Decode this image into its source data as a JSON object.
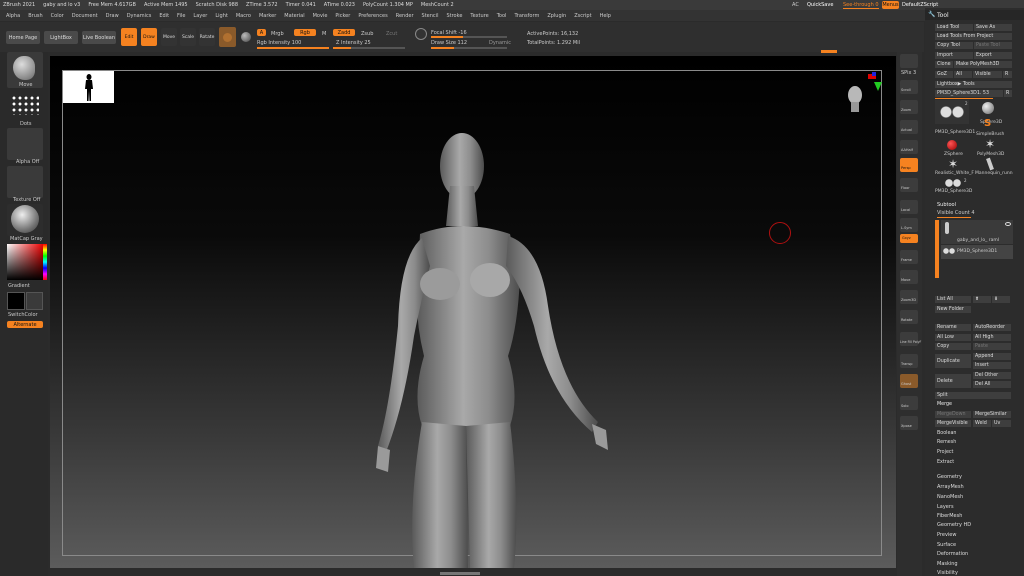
{
  "titlebar": {
    "items": [
      "ZBrush 2021",
      "gaby and lo v3",
      "Free Mem 4.617GB",
      "Active Mem 1495",
      "Scratch Disk 988",
      "ZTime 3.572",
      "Timer 0.041",
      "ATime 0.023",
      "PolyCount 1.304 MP",
      "MeshCount 2"
    ],
    "ai": "AC",
    "quicksave": "QuickSave",
    "seethrough": "See-through  0",
    "menus_btn": "Menus",
    "defaultzscript": "DefaultZScript"
  },
  "menubar": {
    "items": [
      "Alpha",
      "Brush",
      "Color",
      "Document",
      "Draw",
      "Dynamics",
      "Edit",
      "File",
      "Layer",
      "Light",
      "Macro",
      "Marker",
      "Material",
      "Movie",
      "Picker",
      "Preferences",
      "Render",
      "Stencil",
      "Stroke",
      "Texture",
      "Tool",
      "Transform",
      "Zplugin",
      "Zscript",
      "Help"
    ]
  },
  "shelf": {
    "home_page": "Home Page",
    "lightbox": "LightBox",
    "live_boolean": "Live Boolean",
    "edit": "Edit",
    "draw": "Draw",
    "move": "Move",
    "scale": "Scale",
    "rotate": "Rotate",
    "a_label": "A",
    "mrgb": "Mrgb",
    "rgb": "Rgb",
    "m": "M",
    "zadd": "Zadd",
    "zsub": "Zsub",
    "zcut": "Zcut",
    "rgb_intensity": "Rgb Intensity 100",
    "z_intensity": "Z Intensity 25",
    "focal_shift": "Focal Shift -16",
    "draw_size": "Draw Size 112",
    "dynamic": "Dynamic",
    "active_points": "ActivePoints: 16,132",
    "total_points": "TotalPoints: 1.292 Mil"
  },
  "lefttray": {
    "move": "Move",
    "dots": "Dots",
    "alpha_off": "Alpha Off",
    "texture_off": "Texture Off",
    "matcap": "MatCap Gray",
    "gradient": "Gradient",
    "switchcolor": "SwitchColor",
    "alternate": "Alternate"
  },
  "righttray": {
    "spix": "SPix 3",
    "scroll": "Scroll",
    "zoom": "Zoom",
    "actual": "Actual",
    "aahalf": "AAHalf",
    "persp": "Persp",
    "floor": "Floor",
    "local": "Local",
    "lsym": "L.Sym",
    "gxyz": "Gxyz",
    "frame": "Frame",
    "move": "Move",
    "zoom3d": "Zoom3D",
    "rotate": "Rotate",
    "linefill": "Line Fill PolyF",
    "transp": "Transp",
    "ghost": "Ghost",
    "solo": "Solo",
    "xpose": "Xpose"
  },
  "tool": {
    "header": "Tool",
    "load_tool": "Load Tool",
    "save_as": "Save As",
    "load_from_project": "Load Tools From Project",
    "copy_tool": "Copy Tool",
    "paste_tool": "Paste Tool",
    "import": "Import",
    "export": "Export",
    "clone": "Clone",
    "make_polymesh": "Make PolyMesh3D",
    "goz": "GoZ",
    "all": "All",
    "visible": "Visible",
    "r": "R",
    "lightbox_tools": "Lightbox▶ Tools",
    "current_tool": "PM3D_Sphere3D1. 53",
    "r2": "R",
    "thumbs": [
      {
        "label": "PM3D_Sphere3D1",
        "count": "2"
      },
      {
        "label": "Sphere3D",
        "count": ""
      },
      {
        "label": "SimpleBrush",
        "count": ""
      },
      {
        "label": "ZSphere",
        "count": ""
      },
      {
        "label": "PolyMesh3D",
        "count": ""
      },
      {
        "label": "Realistic_White_F",
        "count": ""
      },
      {
        "label": "Mannequin_runn",
        "count": ""
      },
      {
        "label": "PM3D_Sphere3D",
        "count": "2"
      }
    ],
    "subtool": "Subtool",
    "visible_count": "Visible Count 4",
    "subtools": [
      "gaby_and_lo_ raml",
      "PM3D_Sphere3D1"
    ],
    "list_all": "List All",
    "new_folder": "New Folder",
    "rename": "Rename",
    "autoreorder": "AutoReorder",
    "all_low": "All Low",
    "all_high": "All High",
    "copy": "Copy",
    "paste": "Paste",
    "duplicate": "Duplicate",
    "append": "Append",
    "insert": "Insert",
    "delete": "Delete",
    "del_other": "Del Other",
    "del_all": "Del All",
    "split": "Split",
    "merge": "Merge",
    "merge_down": "MergeDown",
    "merge_similar": "MergeSimilar",
    "merge_visible": "MergeVisible",
    "weld": "Weld",
    "uv": "Uv",
    "boolean": "Boolean",
    "remesh": "Remesh",
    "project": "Project",
    "extract": "Extract",
    "sections": [
      "Geometry",
      "ArrayMesh",
      "NanoMesh",
      "Layers",
      "FiberMesh",
      "Geometry HD",
      "Preview",
      "Surface",
      "Deformation",
      "Masking",
      "Visibility"
    ]
  },
  "colors": {
    "accent": "#f58220",
    "bg": "#2b2b2b"
  }
}
